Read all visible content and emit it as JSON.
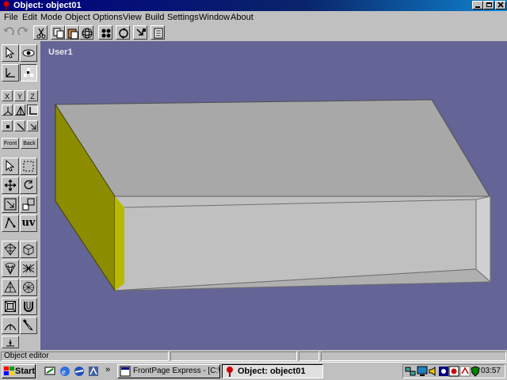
{
  "window": {
    "title": "Object: object01",
    "controls": [
      "minimize-icon",
      "maximize-icon",
      "close-icon"
    ]
  },
  "menu": [
    "File",
    "Edit",
    "Mode",
    "Object",
    "Options",
    "View",
    "Build",
    "Settings",
    "Window",
    "About"
  ],
  "toolbar": {
    "icons": [
      "undo-icon",
      "redo-icon",
      "cut-icon",
      "copy-icon",
      "paste-icon",
      "sphere-icon",
      "grid-icon",
      "refresh-icon",
      "move-icon",
      "list-icon"
    ]
  },
  "palette": {
    "axes": [
      "X",
      "Y",
      "Z"
    ],
    "views": [
      "Front",
      "Back"
    ],
    "uv_label": "uv"
  },
  "viewport": {
    "label": "User1",
    "background": "#646496"
  },
  "statusbar": {
    "text": "Object editor"
  },
  "taskbar": {
    "start_label": "Start",
    "chevron": "»",
    "tasks": [
      {
        "label": "FrontPage Express - [C:\\in...",
        "active": false
      },
      {
        "label": "Object: object01",
        "active": true
      }
    ],
    "clock": "03:57"
  }
}
